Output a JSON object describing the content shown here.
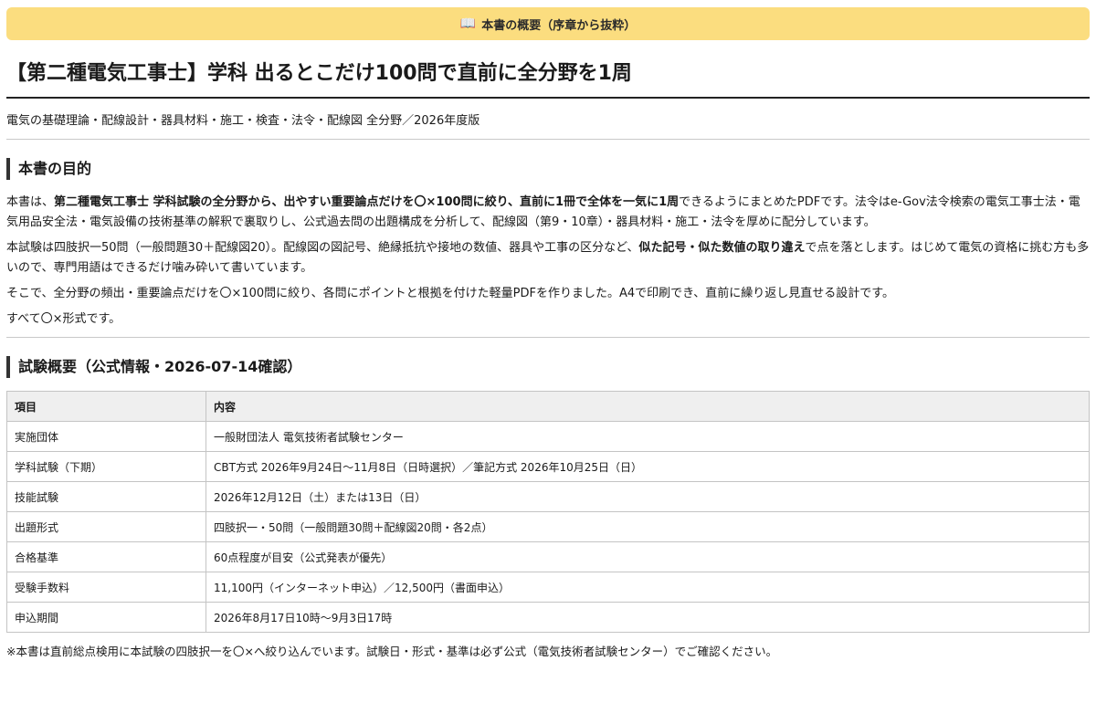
{
  "banner": {
    "icon": "book-icon",
    "text": "本書の概要（序章から抜粋）"
  },
  "title": "【第二種電気工事士】学科 出るとこだけ100問で直前に全分野を1周",
  "subtitle": "電気の基礎理論・配線設計・器具材料・施工・検査・法令・配線図 全分野／2026年度版",
  "purpose": {
    "heading": "本書の目的",
    "p1_a": "本書は、",
    "p1_b": "第二種電気工事士 学科試験の全分野から、出やすい重要論点だけを〇×100問に絞り、直前に1冊で全体を一気に1周",
    "p1_c": "できるようにまとめたPDFです。法令はe-Gov法令検索の電気工事士法・電気用品安全法・電気設備の技術基準の解釈で裏取りし、公式過去問の出題構成を分析して、配線図（第9・10章）・器具材料・施工・法令を厚めに配分しています。",
    "p2_a": "本試験は四肢択一50問（一般問題30＋配線図20）。配線図の図記号、絶縁抵抗や接地の数値、器具や工事の区分など、",
    "p2_b": "似た記号・似た数値の取り違え",
    "p2_c": "で点を落とします。はじめて電気の資格に挑む方も多いので、専門用語はできるだけ噛み砕いて書いています。",
    "p3": "そこで、全分野の頻出・重要論点だけを〇×100問に絞り、各問にポイントと根拠を付けた軽量PDFを作りました。A4で印刷でき、直前に繰り返し見直せる設計です。",
    "p4": "すべて〇×形式です。"
  },
  "exam": {
    "heading": "試験概要（公式情報・2026-07-14確認）",
    "headers": [
      "項目",
      "内容"
    ],
    "rows": [
      [
        "実施団体",
        "一般財団法人 電気技術者試験センター"
      ],
      [
        "学科試験（下期）",
        "CBT方式 2026年9月24日～11月8日（日時選択）／筆記方式 2026年10月25日（日）"
      ],
      [
        "技能試験",
        "2026年12月12日（土）または13日（日）"
      ],
      [
        "出題形式",
        "四肢択一・50問（一般問題30問＋配線図20問・各2点）"
      ],
      [
        "合格基準",
        "60点程度が目安（公式発表が優先）"
      ],
      [
        "受験手数料",
        "11,100円（インターネット申込）／12,500円（書面申込）"
      ],
      [
        "申込期間",
        "2026年8月17日10時～9月3日17時"
      ]
    ]
  },
  "note": "※本書は直前総点検用に本試験の四肢択一を〇×へ絞り込んでいます。試験日・形式・基準は必ず公式（電気技術者試験センター）でご確認ください。"
}
